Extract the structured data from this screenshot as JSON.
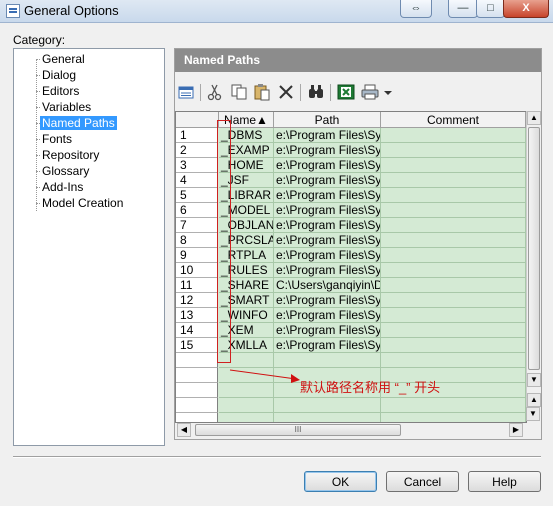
{
  "window": {
    "title": "General Options",
    "resize_glyph": "⇔",
    "min_glyph": "—",
    "max_glyph": "□",
    "close_glyph": "X"
  },
  "category": {
    "label": "Category:",
    "items": [
      "General",
      "Dialog",
      "Editors",
      "Variables",
      "Named Paths",
      "Fonts",
      "Repository",
      "Glossary",
      "Add-Ins",
      "Model Creation"
    ],
    "selected": "Named Paths"
  },
  "panel": {
    "header": "Named Paths",
    "toolbar_icons": [
      "properties-icon",
      "cut-icon",
      "copy-icon",
      "paste-icon",
      "delete-icon",
      "find-icon",
      "excel-export-icon",
      "print-icon",
      "dropdown-arrow-icon"
    ]
  },
  "table": {
    "columns": [
      "Name▲",
      "Path",
      "Comment"
    ],
    "rows": [
      {
        "num": "1",
        "name": "_DBMS",
        "path": "e:\\Program Files\\Syb",
        "comment": ""
      },
      {
        "num": "2",
        "name": "_EXAMP",
        "path": "e:\\Program Files\\Syb",
        "comment": ""
      },
      {
        "num": "3",
        "name": "_HOME",
        "path": "e:\\Program Files\\Syb",
        "comment": ""
      },
      {
        "num": "4",
        "name": "_JSF",
        "path": "e:\\Program Files\\Syb",
        "comment": ""
      },
      {
        "num": "5",
        "name": "_LIBRAR",
        "path": "e:\\Program Files\\Syb",
        "comment": ""
      },
      {
        "num": "6",
        "name": "_MODEL",
        "path": "e:\\Program Files\\Syb",
        "comment": ""
      },
      {
        "num": "7",
        "name": "_OBJLAN",
        "path": "e:\\Program Files\\Syb",
        "comment": ""
      },
      {
        "num": "8",
        "name": "_PRCSLA",
        "path": "e:\\Program Files\\Syb",
        "comment": ""
      },
      {
        "num": "9",
        "name": "_RTPLA",
        "path": "e:\\Program Files\\Syb",
        "comment": ""
      },
      {
        "num": "10",
        "name": "_RULES",
        "path": "e:\\Program Files\\Syb",
        "comment": ""
      },
      {
        "num": "11",
        "name": "_SHARE",
        "path": "C:\\Users\\ganqiyin\\D",
        "comment": ""
      },
      {
        "num": "12",
        "name": "_SMART",
        "path": "e:\\Program Files\\Syb",
        "comment": ""
      },
      {
        "num": "13",
        "name": "_WINFO",
        "path": "e:\\Program Files\\Syb",
        "comment": ""
      },
      {
        "num": "14",
        "name": "_XEM",
        "path": "e:\\Program Files\\Syb",
        "comment": ""
      },
      {
        "num": "15",
        "name": "_XMLLA",
        "path": "e:\\Program Files\\Syb",
        "comment": ""
      }
    ],
    "empty_rows": 5
  },
  "annotation": {
    "text": "默认路径名称用 “_” 开头",
    "color": "#d01010"
  },
  "scroll": {
    "hthumb_glyph": "III"
  },
  "buttons": {
    "ok": "OK",
    "cancel": "Cancel",
    "help": "Help"
  },
  "colors": {
    "grid_bg": "#d4ead4",
    "selection": "#3399ff",
    "header_bg": "#8c8c8c"
  }
}
